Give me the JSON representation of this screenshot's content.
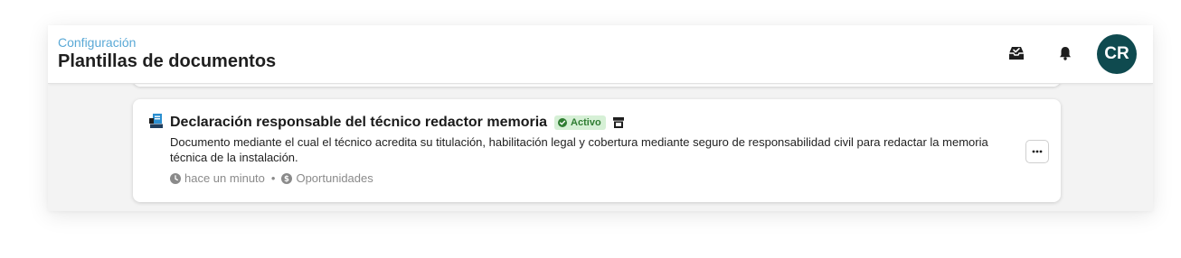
{
  "header": {
    "breadcrumb": "Configuración",
    "title": "Plantillas de documentos",
    "inbox_icon": "inbox-check-icon",
    "bell_icon": "bell-icon",
    "avatar_initials": "CR",
    "avatar_color": "#0f4a4f"
  },
  "card": {
    "icon": "document-template-icon",
    "title": "Declaración responsable del técnico redactor memoria",
    "status": "Activo",
    "status_color": "#2f7d32",
    "status_bg": "#d6f0d6",
    "store_icon": "store-icon",
    "description": "Documento mediante el cual el técnico acredita su titulación, habilitación legal y cobertura mediante seguro de responsabilidad civil para redactar la memoria técnica de la instalación.",
    "meta": {
      "time": "hace un minuto",
      "separator": "•",
      "category": "Oportunidades"
    },
    "menu_icon": "more-horizontal-icon"
  },
  "colors": {
    "breadcrumb": "#5aa9d6",
    "background": "#f3f3f3"
  }
}
